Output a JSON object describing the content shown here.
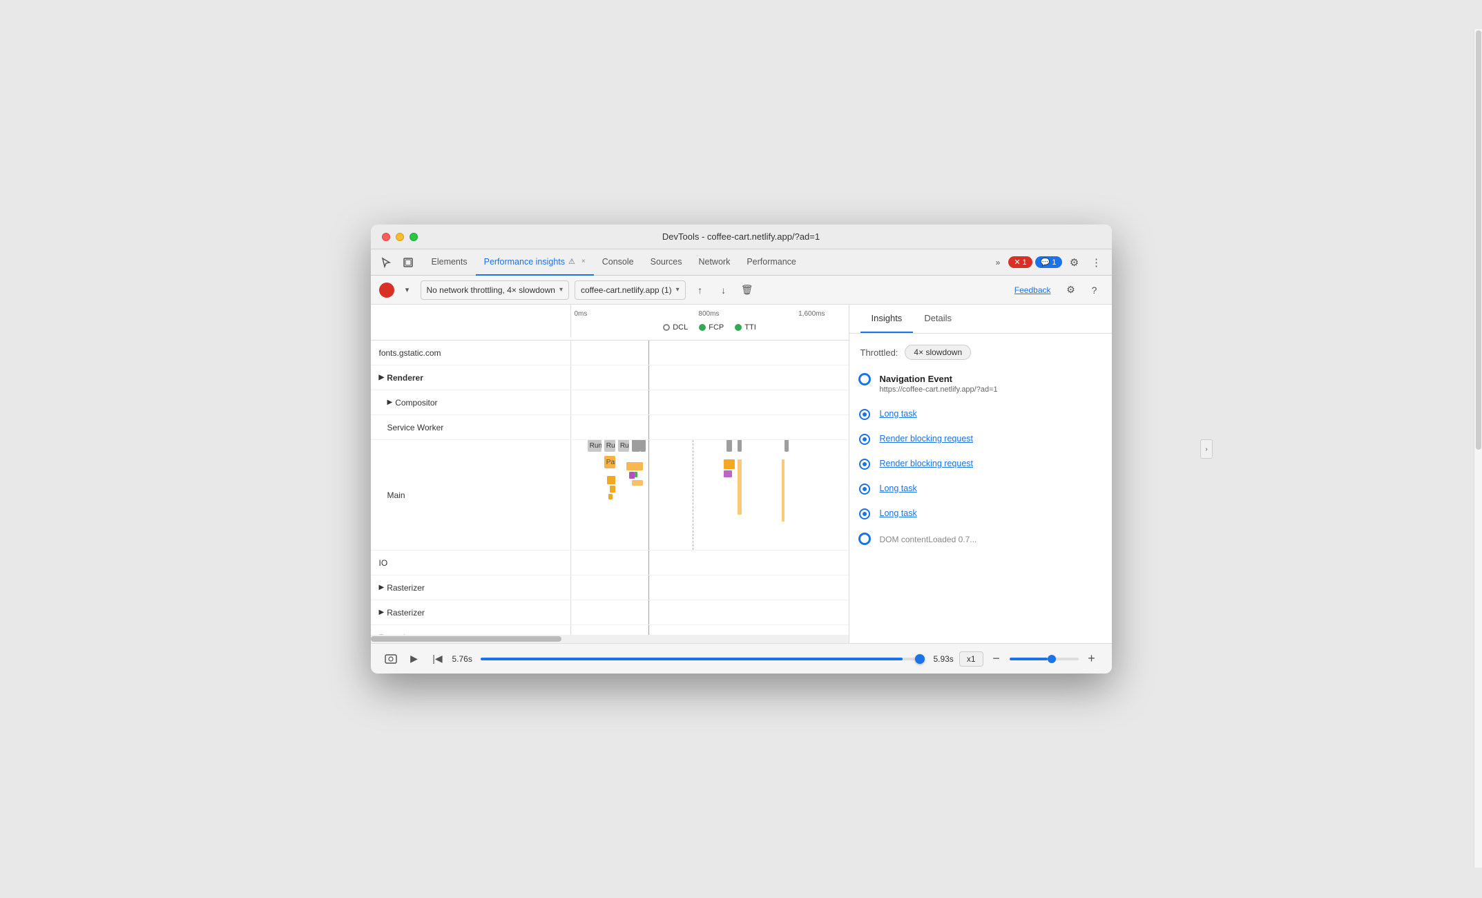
{
  "window": {
    "title": "DevTools - coffee-cart.netlify.app/?ad=1"
  },
  "tabs": {
    "items": [
      {
        "id": "elements",
        "label": "Elements",
        "active": false
      },
      {
        "id": "performance-insights",
        "label": "Performance insights",
        "active": true
      },
      {
        "id": "console",
        "label": "Console",
        "active": false
      },
      {
        "id": "sources",
        "label": "Sources",
        "active": false
      },
      {
        "id": "network",
        "label": "Network",
        "active": false
      },
      {
        "id": "performance",
        "label": "Performance",
        "active": false
      }
    ],
    "more_label": "»",
    "error_count": "1",
    "chat_count": "1",
    "tab_close": "×"
  },
  "toolbar": {
    "throttle_label": "No network throttling, 4× slowdown",
    "target_label": "coffee-cart.netlify.app (1)",
    "feedback_label": "Feedback"
  },
  "timeline": {
    "ruler": {
      "marks": [
        "0ms",
        "800ms",
        "1,600ms"
      ]
    },
    "milestones": [
      "DCL",
      "FCP",
      "TTI"
    ],
    "rows": [
      {
        "label": "fonts.gstatic.com",
        "bold": false,
        "expandable": false,
        "indent": 0
      },
      {
        "label": "Renderer",
        "bold": true,
        "expandable": true,
        "indent": 0
      },
      {
        "label": "Compositor",
        "bold": false,
        "expandable": true,
        "indent": 1
      },
      {
        "label": "Service Worker",
        "bold": false,
        "expandable": false,
        "indent": 1
      },
      {
        "label": "Main",
        "bold": false,
        "expandable": false,
        "indent": 1
      },
      {
        "label": "",
        "bold": false,
        "expandable": false,
        "indent": 1,
        "spacer": true
      },
      {
        "label": "IO",
        "bold": false,
        "expandable": false,
        "indent": 0
      },
      {
        "label": "Rasterizer",
        "bold": false,
        "expandable": true,
        "indent": 0
      },
      {
        "label": "Rasterizer",
        "bold": false,
        "expandable": true,
        "indent": 0
      },
      {
        "label": "Rasterizer",
        "bold": false,
        "expandable": false,
        "indent": 0,
        "partial": true
      }
    ],
    "time_start": "5.76s",
    "time_end": "5.93s",
    "speed": "x1"
  },
  "right_panel": {
    "tabs": [
      "Insights",
      "Details"
    ],
    "active_tab": "Insights",
    "throttle_label": "Throttled:",
    "throttle_value": "4× slowdown",
    "insights": [
      {
        "type": "nav",
        "title": "Navigation Event",
        "url": "https://coffee-cart.netlify.app/?ad=1",
        "open": true
      },
      {
        "type": "link",
        "label": "Long task"
      },
      {
        "type": "link",
        "label": "Render blocking request"
      },
      {
        "type": "link",
        "label": "Render blocking request"
      },
      {
        "type": "link",
        "label": "Long task"
      },
      {
        "type": "link",
        "label": "Long task"
      },
      {
        "type": "partial",
        "label": "DOM contentLoaded 0.7..."
      }
    ]
  },
  "icons": {
    "cursor": "⬆",
    "layers": "⊞",
    "settings": "⚙",
    "more": "⋮",
    "upload": "↑",
    "download": "↓",
    "delete": "🗑",
    "help": "?",
    "play": "▶",
    "skip-back": "|◀",
    "eye": "👁",
    "zoom-in": "+",
    "zoom-out": "−"
  }
}
